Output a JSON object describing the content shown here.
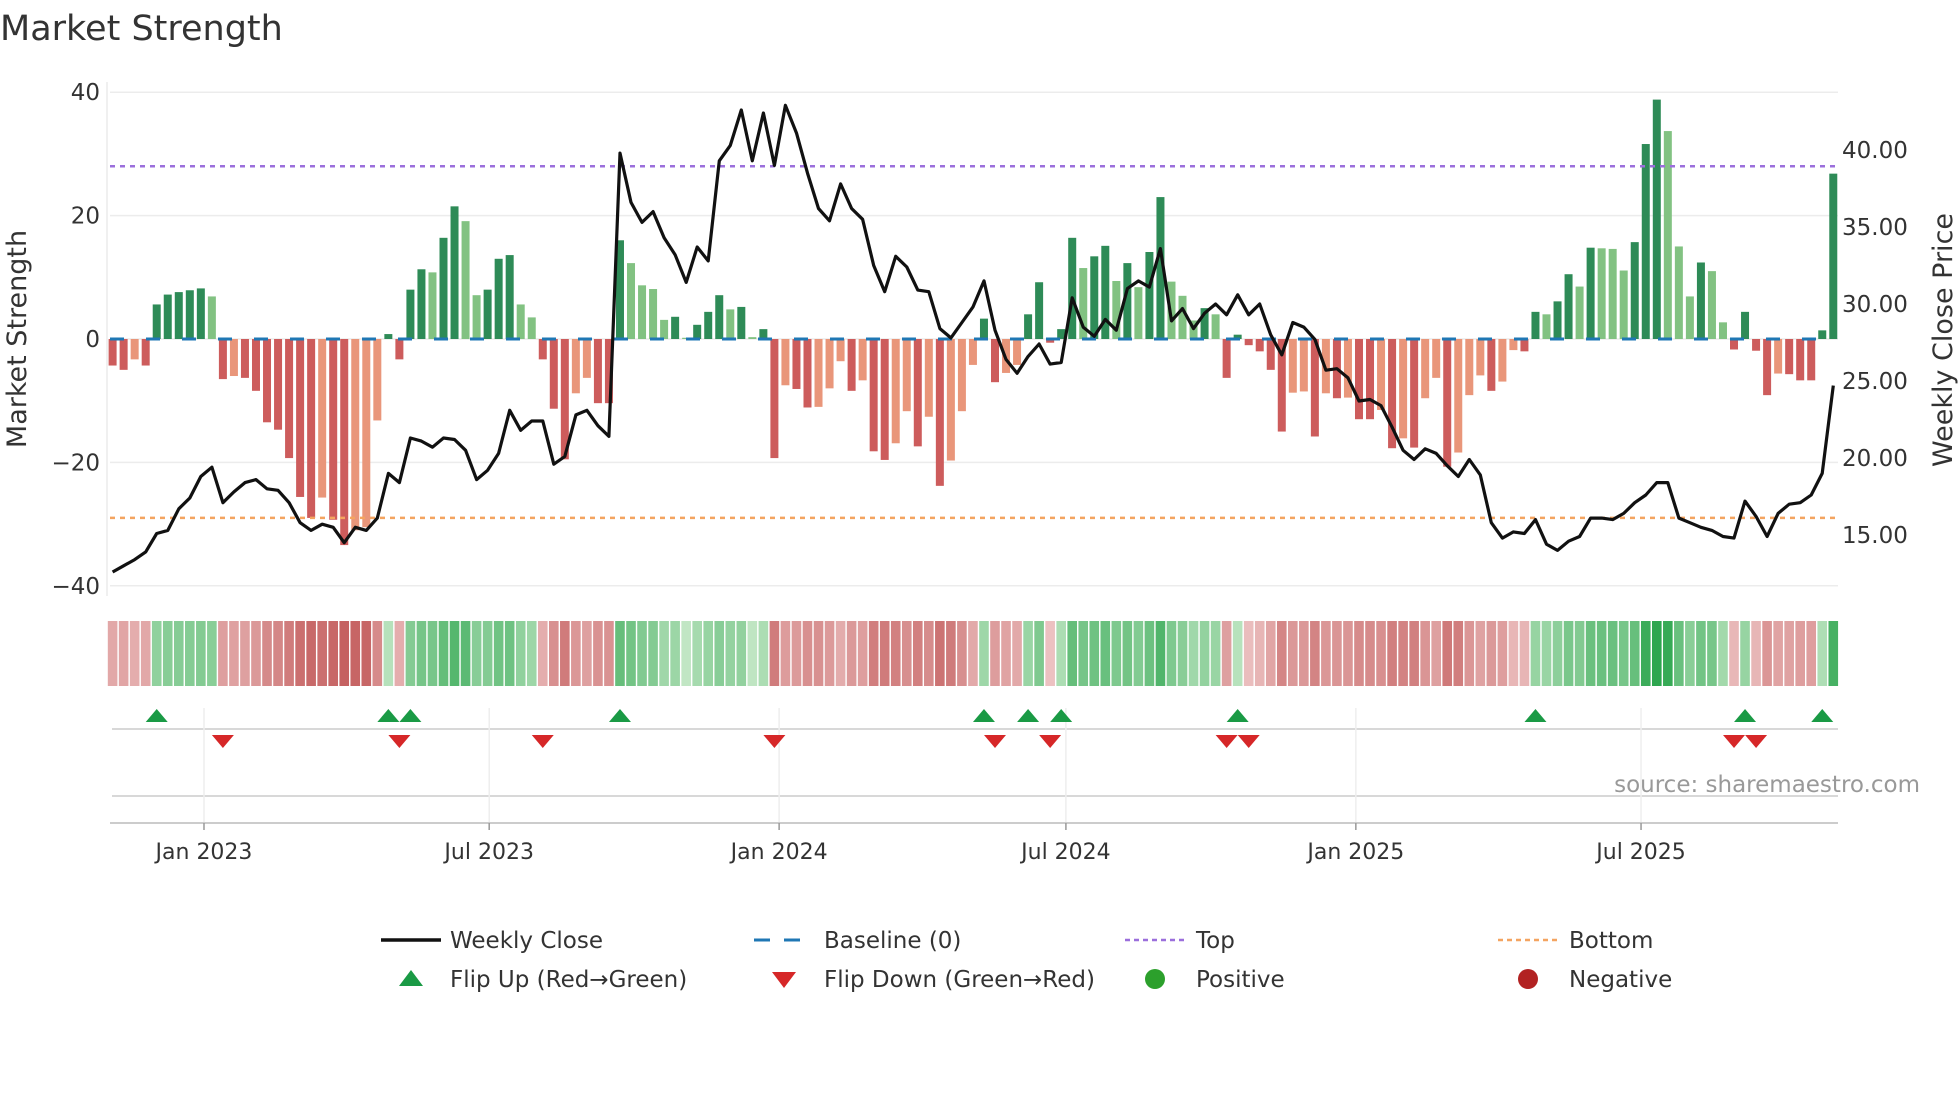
{
  "title": "Market Strength",
  "source": "source: sharemaestro.com",
  "colors": {
    "pos_strong": "#2e8b57",
    "pos_weak": "#82c282",
    "neg_strong": "#cd5c5c",
    "neg_weak": "#e9967a",
    "baseline": "#1f77b4",
    "top": "#9b6fdc",
    "bottom": "#f4a460",
    "flip_up": "#1a9a45",
    "flip_down": "#d62728",
    "positive": "#2ca02c",
    "negative": "#b22222"
  },
  "legend": [
    {
      "label": "Weekly Close",
      "icon": "line-icon"
    },
    {
      "label": "Baseline (0)",
      "icon": "dashed-line-icon"
    },
    {
      "label": "Top",
      "icon": "dotted-line-icon"
    },
    {
      "label": "Bottom",
      "icon": "dotted-line-icon"
    },
    {
      "label": "Flip Up (Red→Green)",
      "icon": "triangle-up-icon"
    },
    {
      "label": "Flip Down (Green→Red)",
      "icon": "triangle-down-icon"
    },
    {
      "label": "Positive",
      "icon": "circle-icon"
    },
    {
      "label": "Negative",
      "icon": "circle-icon"
    }
  ],
  "chart_data": {
    "type": "bar",
    "title": "Market Strength",
    "ylabel": "Market Strength",
    "y2label": "Weekly Close Price",
    "ylim": [
      -42,
      42
    ],
    "y2lim": [
      11.2,
      45.7
    ],
    "yticks": [
      40,
      20,
      0,
      -20,
      -40
    ],
    "ytick_labels": [
      "40",
      "20",
      "0",
      "−20",
      "−40"
    ],
    "y2ticks": [
      40,
      35,
      30,
      25,
      20,
      15
    ],
    "y2tick_labels": [
      "40.00",
      "35.00",
      "30.00",
      "25.00",
      "20.00",
      "15.00"
    ],
    "top_level": 28,
    "bottom_level": -29,
    "start_week": "2022-11-04",
    "xticks": [
      {
        "date": "2023-01-01",
        "label": "Jan 2023"
      },
      {
        "date": "2023-07-01",
        "label": "Jul 2023"
      },
      {
        "date": "2024-01-01",
        "label": "Jan 2024"
      },
      {
        "date": "2024-07-01",
        "label": "Jul 2024"
      },
      {
        "date": "2025-01-01",
        "label": "Jan 2025"
      },
      {
        "date": "2025-07-01",
        "label": "Jul 2025"
      }
    ],
    "strength": [
      -4.3,
      -5,
      -3.3,
      -4.3,
      5.6,
      7.2,
      7.6,
      7.9,
      8.2,
      6.9,
      -6.5,
      -6,
      -6.3,
      -8.4,
      -13.5,
      -14.7,
      -19.3,
      -25.6,
      -29,
      -25.7,
      -29.3,
      -33.4,
      -31,
      -30.5,
      -13.2,
      0.8,
      -3.3,
      8,
      11.3,
      10.8,
      16.4,
      21.5,
      19.1,
      7.1,
      8,
      13,
      13.6,
      5.6,
      3.5,
      -3.3,
      -11.3,
      -19.5,
      -8.8,
      -6.3,
      -10.4,
      -10.4,
      16,
      12.3,
      8.7,
      8.1,
      3.1,
      3.6,
      0.2,
      2.3,
      4.4,
      7.1,
      4.8,
      5.2,
      0.3,
      1.6,
      -19.3,
      -7.5,
      -8.1,
      -11.1,
      -11,
      -8,
      -3.6,
      -8.4,
      -6.7,
      -18.2,
      -19.6,
      -16.9,
      -11.7,
      -17.4,
      -12.6,
      -23.8,
      -19.7,
      -11.7,
      -4.2,
      3.3,
      -7,
      -5.5,
      -4.2,
      4,
      9.2,
      -0.6,
      1.6,
      16.4,
      11.5,
      13.4,
      15.1,
      9.4,
      12.3,
      8.4,
      14.1,
      23,
      9.3,
      7,
      3,
      5,
      4,
      -6.3,
      0.7,
      -1,
      -2,
      -5,
      -15,
      -8.7,
      -8.5,
      -15.8,
      -8.8,
      -9.6,
      -9.5,
      -13,
      -13,
      -11.5,
      -17.7,
      -16.1,
      -17.6,
      -9.6,
      -6.3,
      -20.7,
      -18.4,
      -9.1,
      -5.9,
      -8.4,
      -6.9,
      -1.8,
      -2,
      4.4,
      4,
      6.1,
      10.5,
      8.5,
      14.8,
      14.7,
      14.6,
      11.1,
      15.7,
      31.6,
      38.8,
      33.7,
      15,
      6.9,
      12.4,
      11,
      2.7,
      -1.7,
      4.4,
      -1.9,
      -9.1,
      -5.6,
      -5.7,
      -6.7,
      -6.7,
      1.4,
      26.8
    ],
    "weekly_close": [
      12.6,
      13.0,
      13.4,
      13.9,
      15.1,
      15.3,
      16.7,
      17.4,
      18.8,
      19.4,
      17.1,
      17.8,
      18.4,
      18.6,
      18.0,
      17.9,
      17.1,
      15.8,
      15.3,
      15.7,
      15.5,
      14.5,
      15.5,
      15.3,
      16.1,
      19.0,
      18.4,
      21.3,
      21.1,
      20.7,
      21.3,
      21.2,
      20.5,
      18.6,
      19.2,
      20.3,
      23.1,
      21.8,
      22.4,
      22.4,
      19.6,
      20.1,
      22.8,
      23.1,
      22.1,
      21.4,
      39.8,
      36.6,
      35.3,
      36.0,
      34.3,
      33.2,
      31.4,
      33.7,
      32.8,
      39.3,
      40.3,
      42.6,
      39.3,
      42.4,
      39.0,
      42.9,
      41.1,
      38.5,
      36.2,
      35.4,
      37.8,
      36.2,
      35.5,
      32.5,
      30.8,
      33.1,
      32.4,
      30.9,
      30.8,
      28.4,
      27.8,
      28.8,
      29.8,
      31.5,
      28.3,
      26.4,
      25.5,
      26.6,
      27.4,
      26.1,
      26.2,
      30.4,
      28.5,
      27.9,
      29.0,
      28.3,
      31.0,
      31.5,
      31.1,
      33.6,
      28.9,
      29.7,
      28.4,
      29.4,
      30.0,
      29.3,
      30.6,
      29.3,
      30.0,
      28.0,
      26.7,
      28.8,
      28.5,
      27.7,
      25.7,
      25.8,
      25.2,
      23.7,
      23.8,
      23.4,
      22.0,
      20.5,
      19.9,
      20.6,
      20.3,
      19.5,
      18.8,
      19.9,
      18.9,
      15.8,
      14.8,
      15.2,
      15.1,
      16.0,
      14.4,
      14.0,
      14.6,
      14.9,
      16.1,
      16.1,
      16.0,
      16.4,
      17.1,
      17.6,
      18.4,
      18.4,
      16.1,
      15.8,
      15.5,
      15.3,
      14.9,
      14.8,
      17.2,
      16.2,
      14.9,
      16.4,
      17.0,
      17.1,
      17.6,
      19.0,
      24.7
    ],
    "grid": true,
    "legend_position": "bottom"
  }
}
